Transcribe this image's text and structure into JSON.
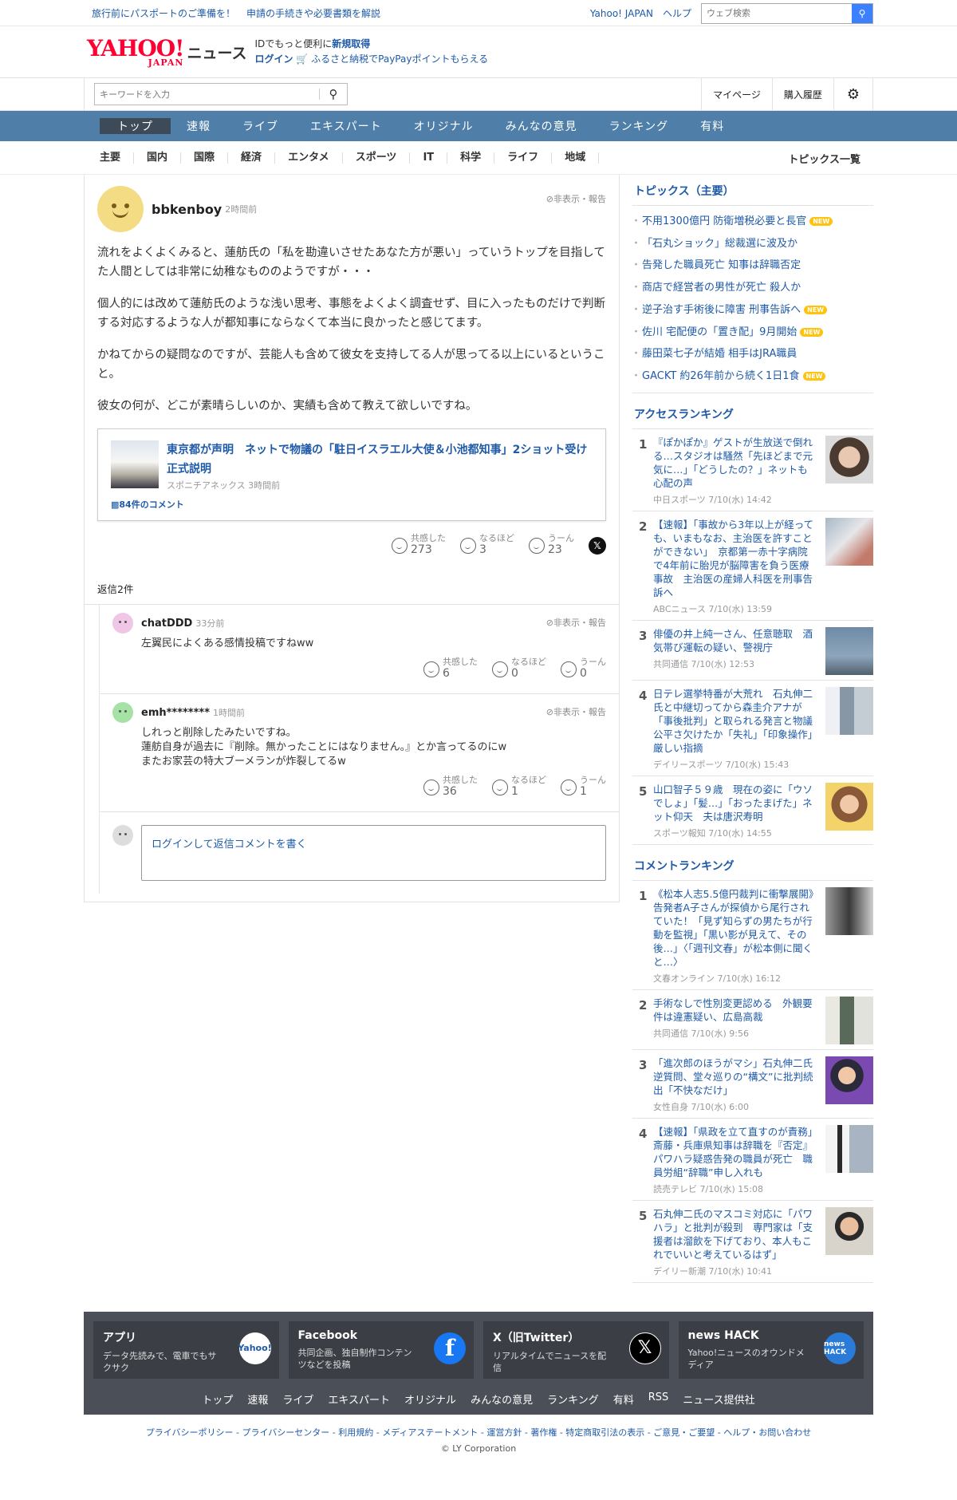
{
  "topbar": {
    "promo1": "旅行前にパスポートのご準備を！",
    "promo2": "申請の手続きや必要書類を解説",
    "yahoo_japan": "Yahoo! JAPAN",
    "help": "ヘルプ",
    "web_search_placeholder": "ウェブ検索"
  },
  "header": {
    "logo_text": "YAHOO!",
    "logo_sub": "JAPAN",
    "news": "ニュース",
    "id_line_prefix": "IDでもっと便利に",
    "id_line_link": "新規取得",
    "login": "ログイン",
    "furusato": "ふるさと納税でPayPayポイントもらえる"
  },
  "search": {
    "placeholder": "キーワードを入力",
    "mypage": "マイページ",
    "history": "購入履歴"
  },
  "gnav": [
    "トップ",
    "速報",
    "ライブ",
    "エキスパート",
    "オリジナル",
    "みんなの意見",
    "ランキング",
    "有料"
  ],
  "cnav": [
    "主要",
    "国内",
    "国際",
    "経済",
    "エンタメ",
    "スポーツ",
    "IT",
    "科学",
    "ライフ",
    "地域"
  ],
  "cnav_all": "トピックス一覧",
  "comment": {
    "user": "bbkenboy",
    "time": "2時間前",
    "report": "非表示・報告",
    "paragraphs": [
      "流れをよくよくみると、蓮舫氏の「私を勘違いさせたあなた方が悪い」っていうトップを目指してた人間としては非常に幼稚なもののようですが・・・",
      "個人的には改めて蓮舫氏のような浅い思考、事態をよくよく調査せず、目に入ったものだけで判断する対応するような人が都知事にならなくて本当に良かったと感じてます。",
      "かねてからの疑問なのですが、芸能人も含めて彼女を支持してる人が思ってる以上にいるということ。",
      "彼女の何が、どこが素晴らしいのか、実績も含めて教えて欲しいですね。"
    ],
    "article": {
      "title": "東京都が声明　ネットで物議の「駐日イスラエル大使＆小池都知事」2ショット受け正式説明",
      "source": "スポニチアネックス 3時間前",
      "comments": "84件のコメント"
    },
    "reactions": {
      "empathy_label": "共感した",
      "empathy": "273",
      "indeed_label": "なるほど",
      "indeed": "3",
      "hmm_label": "うーん",
      "hmm": "23"
    },
    "x_label": "𝕏",
    "reply_count": "返信2件"
  },
  "replies": [
    {
      "user": "chatDDD",
      "time": "33分前",
      "report": "非表示・報告",
      "text": [
        "左翼民によくある感情投稿ですねww"
      ],
      "empathy_label": "共感した",
      "empathy": "6",
      "indeed_label": "なるほど",
      "indeed": "0",
      "hmm_label": "うーん",
      "hmm": "0"
    },
    {
      "user": "emh********",
      "time": "1時間前",
      "report": "非表示・報告",
      "text": [
        "しれっと削除したみたいですね。",
        "蓮舫自身が過去に『削除。無かったことにはなりません。』とか言ってるのにw",
        "またお家芸の特大ブーメランが炸裂してるw"
      ],
      "empathy_label": "共感した",
      "empathy": "36",
      "indeed_label": "なるほど",
      "indeed": "1",
      "hmm_label": "うーん",
      "hmm": "1"
    }
  ],
  "reply_input": "ログインして返信コメントを書く",
  "topics": {
    "heading": "トピックス（主要）",
    "new_label": "NEW",
    "items": [
      {
        "text": "不用1300億円 防衛増税必要と長官",
        "new": true
      },
      {
        "text": "「石丸ショック」総裁選に波及か",
        "new": false
      },
      {
        "text": "告発した職員死亡 知事は辞職否定",
        "new": false
      },
      {
        "text": "商店で経営者の男性が死亡 殺人か",
        "new": false
      },
      {
        "text": "逆子治す手術後に障害 刑事告訴へ",
        "new": true
      },
      {
        "text": "佐川 宅配便の「置き配」9月開始",
        "new": true
      },
      {
        "text": "藤田菜七子が結婚 相手はJRA職員",
        "new": false
      },
      {
        "text": "GACKT 約26年前から続く1日1食",
        "new": true
      }
    ]
  },
  "access_ranking": {
    "heading": "アクセスランキング",
    "items": [
      {
        "rank": "1",
        "title": "『ぽかぽか』ゲストが生放送で倒れる…スタジオは騒然「先ほどまで元気に…」「どうしたの？」ネットも心配の声",
        "source": "中日スポーツ 7/10(水) 14:42"
      },
      {
        "rank": "2",
        "title": "【速報】「事故から3年以上が経っても、いまもなお、主治医を許すことができない」　京都第一赤十字病院で4年前に胎児が脳障害を負う医療事故　主治医の産婦人科医を刑事告訴へ",
        "source": "ABCニュース 7/10(水) 13:59"
      },
      {
        "rank": "3",
        "title": "俳優の井上純一さん、任意聴取　酒気帯び運転の疑い、警視庁",
        "source": "共同通信 7/10(水) 12:53"
      },
      {
        "rank": "4",
        "title": "日テレ選挙特番が大荒れ　石丸伸二氏と中継切ってから森圭介アナが「事後批判」と取られる発言と物議　公平さ欠けたか「失礼」「印象操作」厳しい指摘",
        "source": "デイリースポーツ 7/10(水) 15:43"
      },
      {
        "rank": "5",
        "title": "山口智子５９歳　現在の姿に「ウソでしょ」「髪…」「おったまげた」ネット仰天　夫は唐沢寿明",
        "source": "スポーツ報知 7/10(水) 14:55"
      }
    ]
  },
  "comment_ranking": {
    "heading": "コメントランキング",
    "items": [
      {
        "rank": "1",
        "title": "《松本人志5.5億円裁判に衝撃展開》告発者A子さんが探偵から尾行されていた！「見ず知らずの男たちが行動を監視」「黒い影が見えて、その後…」〈「週刊文春」が松本側に聞くと…〉",
        "source": "文春オンライン 7/10(水) 16:12"
      },
      {
        "rank": "2",
        "title": "手術なしで性別変更認める　外観要件は違憲疑い、広島高裁",
        "source": "共同通信 7/10(水) 9:56"
      },
      {
        "rank": "3",
        "title": "「進次郎のほうがマシ」石丸伸二氏　逆質問、堂々巡りの“構文”に批判続出「不快なだけ」",
        "source": "女性自身 7/10(水) 6:00"
      },
      {
        "rank": "4",
        "title": "【速報】「県政を立て直すのが責務」斎藤・兵庫県知事は辞職を『否定』　パワハラ疑惑告発の職員が死亡　職員労組“辞職”申し入れも",
        "source": "読売テレビ 7/10(水) 15:08"
      },
      {
        "rank": "5",
        "title": "石丸伸二氏のマスコミ対応に「パワハラ」と批判が殺到　専門家は「支援者は溜飲を下げており、本人もこれでいいと考えているはず」",
        "source": "デイリー新潮 7/10(水) 10:41"
      }
    ]
  },
  "footer": {
    "cards": [
      {
        "title": "アプリ",
        "desc": "データ先読みで、電車でもサクサク",
        "icon": "Yahoo!"
      },
      {
        "title": "Facebook",
        "desc": "共同企画、独自制作コンテンツなどを投稿",
        "icon": "f"
      },
      {
        "title": "X（旧Twitter）",
        "desc": "リアルタイムでニュースを配信",
        "icon": "𝕏"
      },
      {
        "title": "news HACK",
        "desc": "Yahoo!ニュースのオウンドメディア",
        "icon": "news HACK"
      }
    ],
    "links": [
      "トップ",
      "速報",
      "ライブ",
      "エキスパート",
      "オリジナル",
      "みんなの意見",
      "ランキング",
      "有料",
      "RSS",
      "ニュース提供社"
    ],
    "legal": "プライバシーポリシー - プライバシーセンター - 利用規約 - メディアステートメント - 運営方針 - 著作権 - 特定商取引法の表示 - ご意見・ご要望 - ヘルプ・お問い合わせ",
    "copyright": "© LY Corporation"
  },
  "colors": {
    "accent": "#1e5aa8",
    "nav": "#4f7fa8",
    "nav_active": "#3d4a57",
    "footer": "#4b4f57",
    "new_badge": "#ffc20e"
  }
}
